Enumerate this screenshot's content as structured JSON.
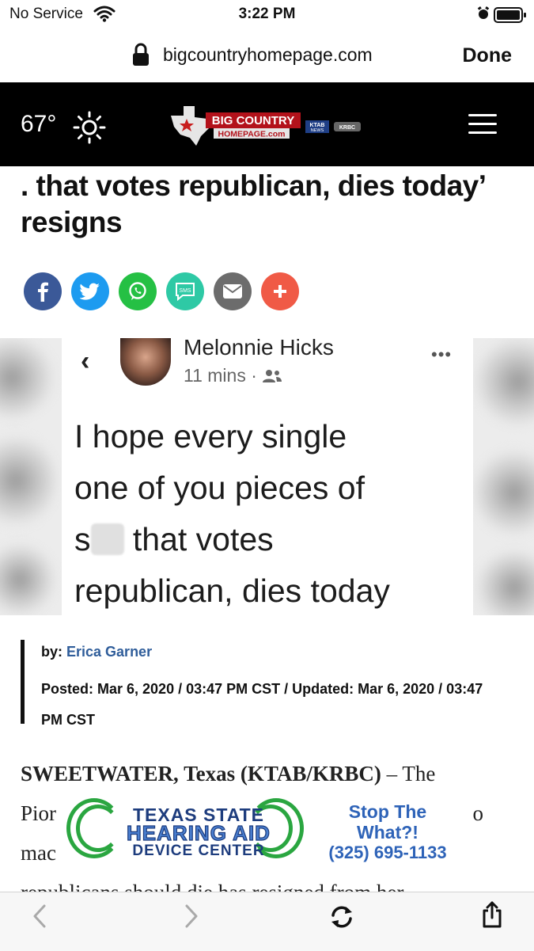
{
  "status": {
    "carrier": "No Service",
    "time": "3:22 PM"
  },
  "urlbar": {
    "domain": "bigcountryhomepage.com",
    "done_label": "Done"
  },
  "site_header": {
    "temperature": "67°",
    "weather_icon": "sun-icon",
    "logo_lines": [
      "BIG COUNTRY",
      "HOMEPAGE.com"
    ],
    "partner_logos": [
      "KTAB NEWS",
      "KRBC"
    ]
  },
  "headline": {
    "text": "said she hopes ‘every single one’ . . . that votes republican, dies today’ resigns"
  },
  "share": {
    "buttons": [
      {
        "name": "facebook",
        "label": "f",
        "color": "#3b5998"
      },
      {
        "name": "twitter",
        "label": "t",
        "color": "#1d9bf0"
      },
      {
        "name": "whatsapp",
        "label": "w",
        "color": "#25c044"
      },
      {
        "name": "sms",
        "label": "SMS",
        "color": "#2ec9a5"
      },
      {
        "name": "email",
        "label": "email",
        "color": "#6c6c6c"
      },
      {
        "name": "more",
        "label": "+",
        "color": "#f05a46"
      }
    ]
  },
  "hero_image": {
    "author_name": "Melonnie Hicks",
    "post_time": "11 mins ·",
    "post_line1": "I hope every single",
    "post_line2": "one of you pieces of",
    "post_line3_pre": "s",
    "post_line3_post": " that votes",
    "post_line4": "republican, dies today"
  },
  "byline": {
    "by_label": "by:",
    "author": "Erica Garner",
    "posted": "Posted: Mar 6, 2020 / 03:47 PM CST / Updated: Mar 6, 2020 / 03:47 PM CST"
  },
  "body": {
    "dateline": "SWEETWATER, Texas (KTAB/KRBC)",
    "dash_text": " – The",
    "line2_start": "Pior",
    "line2_end": "o",
    "line3_start": "mac",
    "line4": "republicans should die has resigned from her"
  },
  "ad": {
    "line1": "TEXAS STATE",
    "line2": "HEARING AID",
    "line3": "DEVICE CENTER",
    "right1": "Stop The",
    "right2": "What?!",
    "phone": "(325) 695-1133"
  },
  "colors": {
    "header_bg": "#000000",
    "author_link": "#2f5d9a",
    "ad_green": "#2aa640",
    "ad_blue": "#1d3c7d"
  }
}
